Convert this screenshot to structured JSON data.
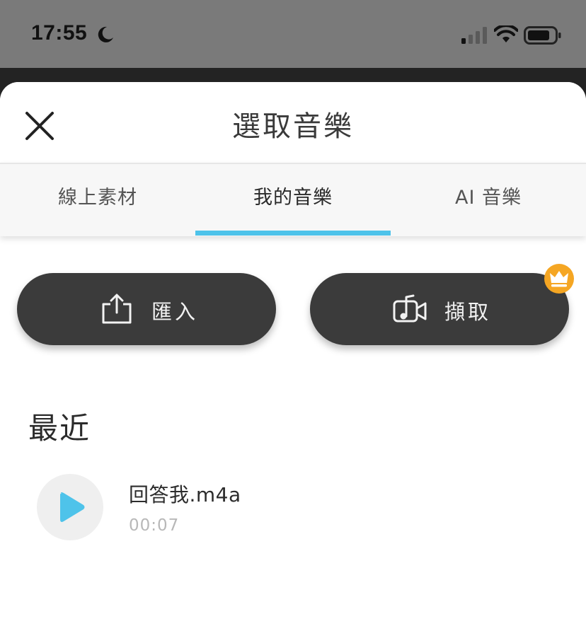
{
  "status_bar": {
    "time": "17:55"
  },
  "header": {
    "title": "選取音樂"
  },
  "tabs": [
    {
      "label": "線上素材",
      "active": false
    },
    {
      "label": "我的音樂",
      "active": true
    },
    {
      "label": "AI 音樂",
      "active": false
    }
  ],
  "actions": {
    "import_label": "匯入",
    "extract_label": "擷取"
  },
  "recent": {
    "title": "最近",
    "items": [
      {
        "name": "回答我.m4a",
        "duration": "00:07"
      }
    ]
  },
  "colors": {
    "accent": "#4ec3ea",
    "button_bg": "#3b3b3b",
    "badge": "#f5a623"
  },
  "icons": {
    "close": "close-icon",
    "import": "share-upload-icon",
    "extract": "video-music-icon",
    "premium": "crown-icon",
    "play": "play-icon"
  }
}
